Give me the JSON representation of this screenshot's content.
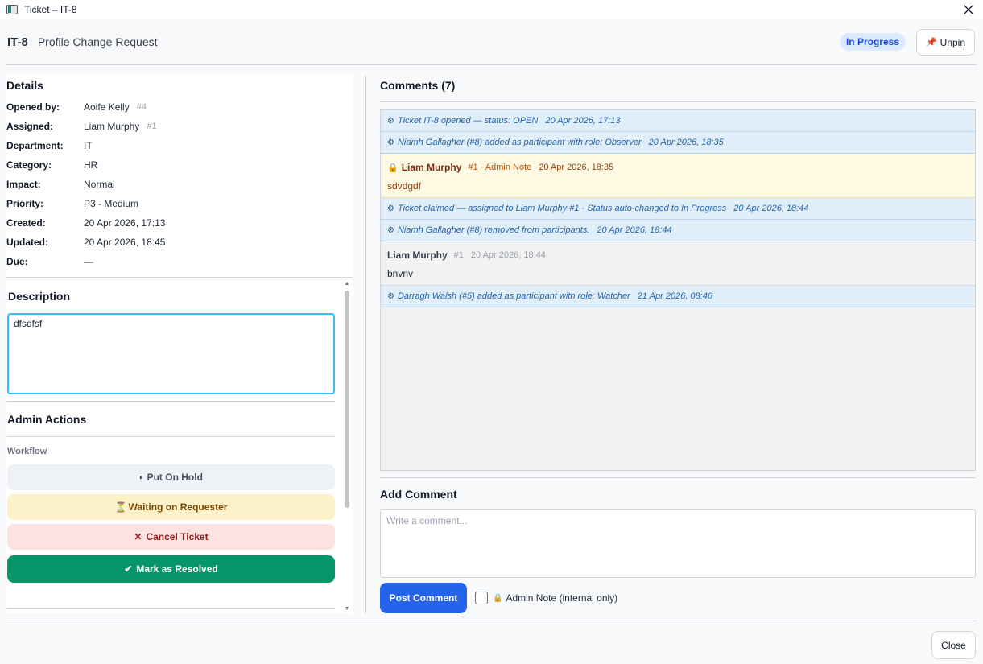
{
  "window": {
    "title": "Ticket – IT-8"
  },
  "header": {
    "ticket_key": "IT-8",
    "subject": "Profile Change Request",
    "status": "In Progress",
    "unpin_label": "Unpin"
  },
  "details": {
    "title": "Details",
    "rows": [
      {
        "label": "Opened by:",
        "value": "Aoife Kelly",
        "num": "#4"
      },
      {
        "label": "Assigned:",
        "value": "Liam Murphy",
        "num": "#1"
      },
      {
        "label": "Department:",
        "value": "IT"
      },
      {
        "label": "Category:",
        "value": "HR"
      },
      {
        "label": "Impact:",
        "value": "Normal"
      },
      {
        "label": "Priority:",
        "value": "P3 - Medium"
      },
      {
        "label": "Created:",
        "value": "20 Apr 2026, 17:13"
      },
      {
        "label": "Updated:",
        "value": "20 Apr 2026, 18:45"
      },
      {
        "label": "Due:",
        "value": "—"
      }
    ]
  },
  "description": {
    "title": "Description",
    "text": "dfsdfsf"
  },
  "admin_actions": {
    "title": "Admin Actions",
    "workflow_label": "Workflow",
    "buttons": [
      {
        "icon": "⏸",
        "label": "Put On Hold"
      },
      {
        "icon": "⏳",
        "label": "Waiting on Requester"
      },
      {
        "icon": "✕",
        "label": "Cancel Ticket"
      },
      {
        "icon": "✔",
        "label": "Mark as Resolved"
      }
    ]
  },
  "comments": {
    "title": "Comments (7)",
    "items": [
      {
        "type": "system",
        "text": "Ticket IT-8 opened — status: OPEN",
        "time": "20 Apr 2026, 17:13"
      },
      {
        "type": "system",
        "text": "Niamh Gallagher (#8) added as participant with role: Observer",
        "time": "20 Apr 2026, 18:35"
      },
      {
        "type": "note",
        "author": "Liam Murphy",
        "meta": "#1 · Admin Note",
        "time": "20 Apr 2026, 18:35",
        "body": "sdvdgdf"
      },
      {
        "type": "system",
        "text": "Ticket claimed — assigned to Liam Murphy #1 · Status auto-changed to In Progress",
        "time": "20 Apr 2026, 18:44"
      },
      {
        "type": "system",
        "text": "Niamh Gallagher (#8) removed from participants.",
        "time": "20 Apr 2026, 18:44"
      },
      {
        "type": "comment",
        "author": "Liam Murphy",
        "num": "#1",
        "time": "20 Apr 2026, 18:44",
        "body": "bnvnv"
      },
      {
        "type": "system",
        "text": "Darragh Walsh (#5) added as participant with role: Watcher",
        "time": "21 Apr 2026, 08:46"
      }
    ]
  },
  "add_comment": {
    "title": "Add Comment",
    "placeholder": "Write a comment...",
    "post_label": "Post Comment",
    "admin_note_label": "Admin Note (internal only)"
  },
  "footer": {
    "close_label": "Close"
  },
  "colors": {
    "accent": "#2563eb",
    "status_pill_bg": "#dbeafe",
    "resolve_green": "#059669",
    "system_row_bg": "#e0eefa",
    "note_row_bg": "#fef9e3"
  }
}
